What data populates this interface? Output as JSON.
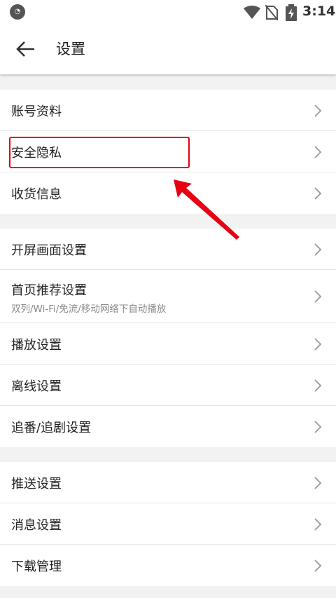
{
  "statusbar": {
    "time": "3:14"
  },
  "header": {
    "title": "设置"
  },
  "groups": [
    {
      "items": [
        {
          "label": "账号资料"
        },
        {
          "label": "安全隐私"
        },
        {
          "label": "收货信息"
        }
      ]
    },
    {
      "items": [
        {
          "label": "开屏画面设置"
        },
        {
          "label": "首页推荐设置",
          "sub": "双列/Wi-Fi/免流/移动网络下自动播放"
        },
        {
          "label": "播放设置"
        },
        {
          "label": "离线设置"
        },
        {
          "label": "追番/追剧设置"
        }
      ]
    },
    {
      "items": [
        {
          "label": "推送设置"
        },
        {
          "label": "消息设置"
        },
        {
          "label": "下载管理"
        }
      ]
    }
  ],
  "colors": {
    "highlight": "#e60012",
    "background": "#f2f2f2"
  }
}
